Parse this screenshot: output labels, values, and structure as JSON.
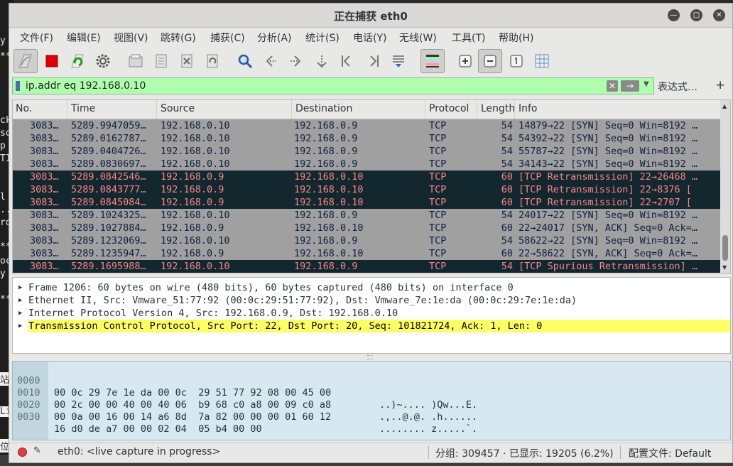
{
  "window": {
    "title": "正在捕获 eth0"
  },
  "menu": [
    "文件(F)",
    "编辑(E)",
    "视图(V)",
    "跳转(G)",
    "捕获(C)",
    "分析(A)",
    "统计(S)",
    "电话(Y)",
    "无线(W)",
    "工具(T)",
    "帮助(H)"
  ],
  "toolbar": {
    "buttons": [
      "start-capture-icon",
      "stop-capture-icon",
      "restart-capture-icon",
      "capture-options-icon",
      "open-file-icon",
      "save-file-icon",
      "close-file-icon",
      "reload-file-icon",
      "find-packet-icon",
      "go-back-icon",
      "go-forward-icon",
      "go-to-packet-icon",
      "go-first-icon",
      "go-last-icon",
      "auto-scroll-icon",
      "colorize-icon",
      "zoom-in-icon",
      "zoom-out-icon",
      "normal-size-icon",
      "resize-columns-icon"
    ]
  },
  "filter": {
    "value": "ip.addr eq 192.168.0.10",
    "expression_label": "表达式…",
    "plus": "+",
    "clear": "✕",
    "apply": "→"
  },
  "packet_list": {
    "columns": [
      "No.",
      "Time",
      "Source",
      "Destination",
      "Protocol",
      "Length",
      "Info"
    ],
    "rows": [
      {
        "no": "3083…",
        "time": "5289.9947059…",
        "src": "192.168.0.10",
        "dst": "192.168.0.9",
        "proto": "TCP",
        "len": "54",
        "info": "14879→22 [SYN] Seq=0 Win=8192 …",
        "style": "normal"
      },
      {
        "no": "3083…",
        "time": "5289.0162787…",
        "src": "192.168.0.10",
        "dst": "192.168.0.9",
        "proto": "TCP",
        "len": "54",
        "info": "54392→22 [SYN] Seq=0 Win=8192 …",
        "style": "normal"
      },
      {
        "no": "3083…",
        "time": "5289.0404726…",
        "src": "192.168.0.10",
        "dst": "192.168.0.9",
        "proto": "TCP",
        "len": "54",
        "info": "55787→22 [SYN] Seq=0 Win=8192 …",
        "style": "normal"
      },
      {
        "no": "3083…",
        "time": "5289.0830697…",
        "src": "192.168.0.10",
        "dst": "192.168.0.9",
        "proto": "TCP",
        "len": "54",
        "info": "34143→22 [SYN] Seq=0 Win=8192 …",
        "style": "normal"
      },
      {
        "no": "3083…",
        "time": "5289.0842546…",
        "src": "192.168.0.9",
        "dst": "192.168.0.10",
        "proto": "TCP",
        "len": "60",
        "info": "[TCP Retransmission] 22→26468 …",
        "style": "dark"
      },
      {
        "no": "3083…",
        "time": "5289.0843777…",
        "src": "192.168.0.9",
        "dst": "192.168.0.10",
        "proto": "TCP",
        "len": "60",
        "info": "[TCP Retransmission] 22→8376 [",
        "style": "dark"
      },
      {
        "no": "3083…",
        "time": "5289.0845084…",
        "src": "192.168.0.9",
        "dst": "192.168.0.10",
        "proto": "TCP",
        "len": "60",
        "info": "[TCP Retransmission] 22→2707 [",
        "style": "dark"
      },
      {
        "no": "3083…",
        "time": "5289.1024325…",
        "src": "192.168.0.10",
        "dst": "192.168.0.9",
        "proto": "TCP",
        "len": "54",
        "info": "24017→22 [SYN] Seq=0 Win=8192 …",
        "style": "normal"
      },
      {
        "no": "3083…",
        "time": "5289.1027884…",
        "src": "192.168.0.9",
        "dst": "192.168.0.10",
        "proto": "TCP",
        "len": "60",
        "info": "22→24017 [SYN, ACK] Seq=0 Ack=…",
        "style": "normal"
      },
      {
        "no": "3083…",
        "time": "5289.1232069…",
        "src": "192.168.0.10",
        "dst": "192.168.0.9",
        "proto": "TCP",
        "len": "54",
        "info": "58622→22 [SYN] Seq=0 Win=8192 …",
        "style": "normal"
      },
      {
        "no": "3083…",
        "time": "5289.1235947…",
        "src": "192.168.0.9",
        "dst": "192.168.0.10",
        "proto": "TCP",
        "len": "60",
        "info": "22→58622 [SYN, ACK] Seq=0 Ack=…",
        "style": "normal"
      },
      {
        "no": "3083…",
        "time": "5289.1695988…",
        "src": "192.168.0.10",
        "dst": "192.168.0.9",
        "proto": "TCP",
        "len": "54",
        "info": "[TCP Spurious Retransmission] …",
        "style": "dark"
      }
    ]
  },
  "details": [
    {
      "text": "Frame 1206: 60 bytes on wire (480 bits), 60 bytes captured (480 bits) on interface 0",
      "selected": false
    },
    {
      "text": "Ethernet II, Src: Vmware_51:77:92 (00:0c:29:51:77:92), Dst: Vmware_7e:1e:da (00:0c:29:7e:1e:da)",
      "selected": false
    },
    {
      "text": "Internet Protocol Version 4, Src: 192.168.0.9, Dst: 192.168.0.10",
      "selected": false
    },
    {
      "text": "Transmission Control Protocol, Src Port: 22, Dst Port: 20, Seq: 101821724, Ack: 1, Len: 0",
      "selected": true
    }
  ],
  "bytes": [
    {
      "offset": "0000",
      "hex": "00 0c 29 7e 1e da 00 0c  29 51 77 92 08 00 45 00",
      "ascii": "..)~.... )Qw...E."
    },
    {
      "offset": "0010",
      "hex": "00 2c 00 00 40 00 40 06  b9 68 c0 a8 00 09 c0 a8",
      "ascii": ".,..@.@. .h......"
    },
    {
      "offset": "0020",
      "hex": "00 0a 00 16 00 14 a6 8d  7a 82 00 00 00 01 60 12",
      "ascii": "........ z.....`."
    },
    {
      "offset": "0030",
      "hex": "16 d0 de a7 00 00 02 04  05 b4 00 00",
      "ascii": "........ ...."
    }
  ],
  "status": {
    "interface": "eth0: <live capture in progress>",
    "packets": "分组: 309457 · 已显示: 19205 (6.2%)",
    "profile": "配置文件: Default"
  },
  "background_fragments": [
    "y",
    "**",
    "ck",
    "so",
    "p",
    "TI",
    "l",
    "..",
    "ro",
    "**",
    "oc",
    "y",
    "**",
    "站",
    "Liv",
    "位"
  ]
}
